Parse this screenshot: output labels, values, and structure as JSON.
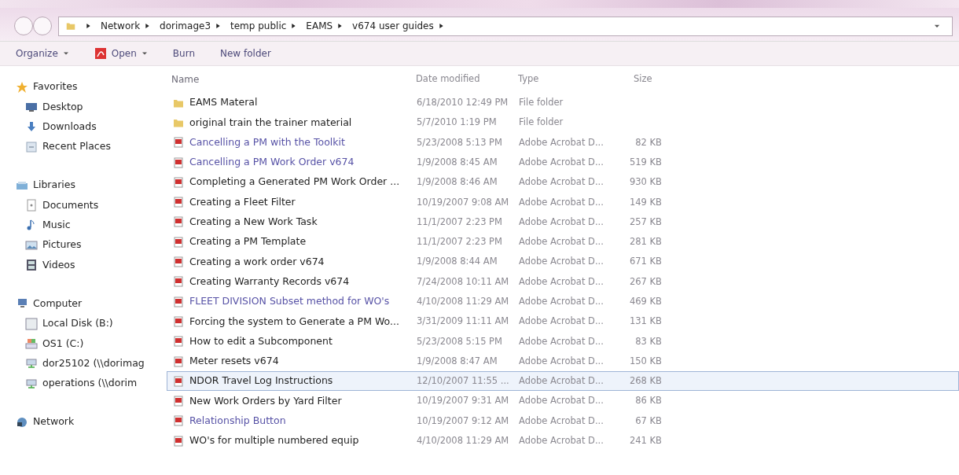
{
  "address_bar": {
    "segments": [
      "Network",
      "dorimage3",
      "temp public",
      "EAMS",
      "v674 user guides"
    ]
  },
  "toolbar": {
    "buttons": [
      {
        "label": "Organize",
        "kind": "menu"
      },
      {
        "label": "Open",
        "kind": "pdf-menu"
      },
      {
        "label": "Burn",
        "kind": "plain"
      },
      {
        "label": "New folder",
        "kind": "plain"
      }
    ]
  },
  "sidebar": {
    "groups": [
      {
        "label": "Favorites",
        "kind": "star",
        "children": [
          {
            "label": "Desktop",
            "kind": "desktop"
          },
          {
            "label": "Downloads",
            "kind": "download"
          },
          {
            "label": "Recent Places",
            "kind": "recent"
          }
        ]
      },
      {
        "label": "Libraries",
        "kind": "library",
        "children": [
          {
            "label": "Documents",
            "kind": "document"
          },
          {
            "label": "Music",
            "kind": "music"
          },
          {
            "label": "Pictures",
            "kind": "pictures"
          },
          {
            "label": "Videos",
            "kind": "video"
          }
        ]
      },
      {
        "label": "Computer",
        "kind": "computer",
        "children": [
          {
            "label": "Local Disk (B:)",
            "kind": "disk"
          },
          {
            "label": "OS1 (C:)",
            "kind": "osdisk"
          },
          {
            "label": "dor25102 (\\\\dorimag",
            "kind": "share"
          },
          {
            "label": "operations (\\\\dorim",
            "kind": "share"
          }
        ]
      },
      {
        "label": "Network",
        "kind": "network"
      }
    ]
  },
  "table": {
    "columns": [
      "Name",
      "Date modified",
      "Type",
      "Size"
    ],
    "rows": [
      {
        "kind": "folder",
        "name": "EAMS Materal",
        "date": "6/18/2010 12:49 PM",
        "type": "File folder",
        "highlighted": false,
        "selected": false
      },
      {
        "kind": "folder",
        "name": "original train the trainer material",
        "date": "5/7/2010 1:19 PM",
        "type": "File folder",
        "highlighted": false,
        "selected": false
      },
      {
        "kind": "pdf",
        "name": "Cancelling a PM with the Toolkit",
        "date": "5/23/2008 5:13 PM",
        "type": "Adobe Acrobat D...",
        "size": "82 KB",
        "highlighted": true,
        "selected": false
      },
      {
        "kind": "pdf",
        "name": "Cancelling a PM Work Order v674",
        "date": "1/9/2008 8:45 AM",
        "type": "Adobe Acrobat D...",
        "size": "519 KB",
        "highlighted": true,
        "selected": false
      },
      {
        "kind": "pdf",
        "name": "Completing a Generated PM Work Order ...",
        "date": "1/9/2008 8:46 AM",
        "type": "Adobe Acrobat D...",
        "size": "930 KB",
        "highlighted": false,
        "selected": false
      },
      {
        "kind": "pdf",
        "name": "Creating a Fleet Filter",
        "date": "10/19/2007 9:08 AM",
        "type": "Adobe Acrobat D...",
        "size": "149 KB",
        "highlighted": false,
        "selected": false
      },
      {
        "kind": "pdf",
        "name": "Creating a New Work Task",
        "date": "11/1/2007 2:23 PM",
        "type": "Adobe Acrobat D...",
        "size": "257 KB",
        "highlighted": false,
        "selected": false
      },
      {
        "kind": "pdf",
        "name": "Creating a PM Template",
        "date": "11/1/2007 2:23 PM",
        "type": "Adobe Acrobat D...",
        "size": "281 KB",
        "highlighted": false,
        "selected": false
      },
      {
        "kind": "pdf",
        "name": "Creating a work order v674",
        "date": "1/9/2008 8:44 AM",
        "type": "Adobe Acrobat D...",
        "size": "671 KB",
        "highlighted": false,
        "selected": false
      },
      {
        "kind": "pdf",
        "name": "Creating Warranty Records v674",
        "date": "7/24/2008 10:11 AM",
        "type": "Adobe Acrobat D...",
        "size": "267 KB",
        "highlighted": false,
        "selected": false
      },
      {
        "kind": "pdf",
        "name": "FLEET DIVISION Subset method for WO's",
        "date": "4/10/2008 11:29 AM",
        "type": "Adobe Acrobat D...",
        "size": "469 KB",
        "highlighted": true,
        "selected": false
      },
      {
        "kind": "pdf",
        "name": "Forcing the system to Generate a PM Wo...",
        "date": "3/31/2009 11:11 AM",
        "type": "Adobe Acrobat D...",
        "size": "131 KB",
        "highlighted": false,
        "selected": false
      },
      {
        "kind": "pdf",
        "name": "How to edit a Subcomponent",
        "date": "5/23/2008 5:15 PM",
        "type": "Adobe Acrobat D...",
        "size": "83 KB",
        "highlighted": false,
        "selected": false
      },
      {
        "kind": "pdf",
        "name": "Meter resets v674",
        "date": "1/9/2008 8:47 AM",
        "type": "Adobe Acrobat D...",
        "size": "150 KB",
        "highlighted": false,
        "selected": false
      },
      {
        "kind": "pdf",
        "name": "NDOR Travel Log Instructions",
        "date": "12/10/2007 11:55 ...",
        "type": "Adobe Acrobat D...",
        "size": "268 KB",
        "highlighted": false,
        "selected": true
      },
      {
        "kind": "pdf",
        "name": "New Work Orders by Yard Filter",
        "date": "10/19/2007 9:31 AM",
        "type": "Adobe Acrobat D...",
        "size": "86 KB",
        "highlighted": false,
        "selected": false
      },
      {
        "kind": "pdf",
        "name": "Relationship Button",
        "date": "10/19/2007 9:12 AM",
        "type": "Adobe Acrobat D...",
        "size": "67 KB",
        "highlighted": true,
        "selected": false
      },
      {
        "kind": "pdf",
        "name": "WO's for multiple numbered equip",
        "date": "4/10/2008 11:29 AM",
        "type": "Adobe Acrobat D...",
        "size": "241 KB",
        "highlighted": false,
        "selected": false
      }
    ]
  }
}
